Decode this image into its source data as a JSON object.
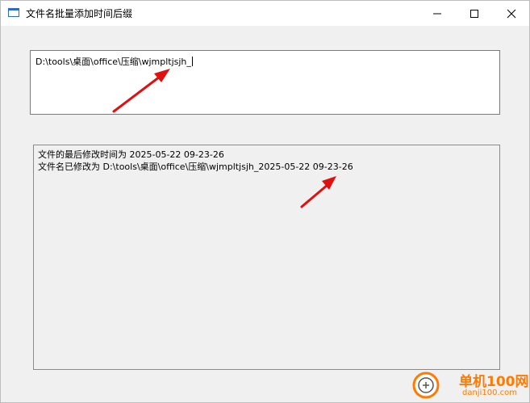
{
  "window": {
    "title": "文件名批量添加时间后缀"
  },
  "path_field": {
    "value": "D:\\tools\\桌面\\office\\压缩\\wjmpltjsjh_"
  },
  "log": {
    "lines": [
      "文件的最后修改时间为 2025-05-22 09-23-26",
      "文件名已修改为 D:\\tools\\桌面\\office\\压缩\\wjmpltjsjh_2025-05-22 09-23-26"
    ]
  },
  "watermark": {
    "name": "单机100网",
    "url": "danji100.com"
  },
  "colors": {
    "annotation_arrow": "#e01010",
    "watermark": "#ff7a00",
    "accent": "#2b6cc4"
  }
}
